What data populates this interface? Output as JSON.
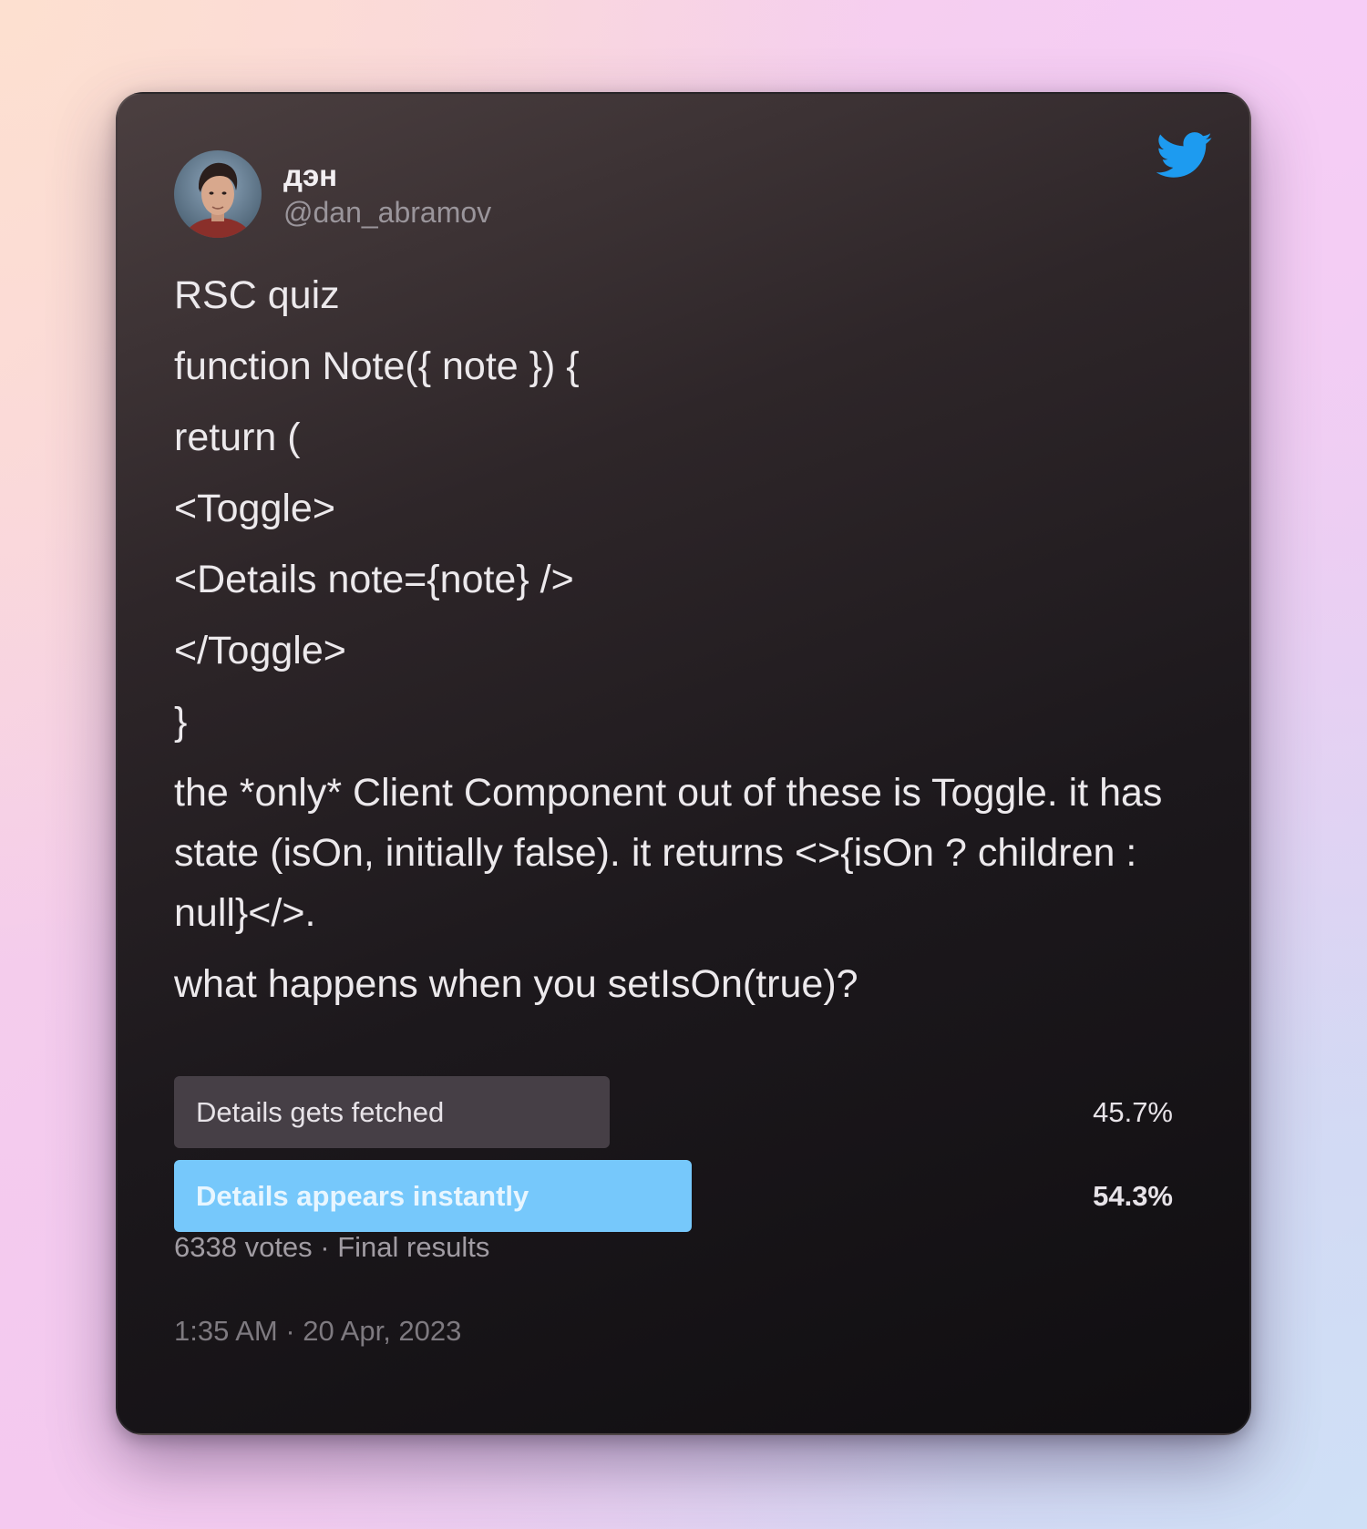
{
  "author": {
    "display_name": "дэн",
    "handle": "@dan_abramov"
  },
  "tweet": {
    "lines": [
      "RSC quiz",
      "function Note({ note }) {",
      "return (",
      "<Toggle>",
      "<Details note={note} />",
      "</Toggle>",
      "}"
    ],
    "paragraph": "the *only* Client Component out of these is Toggle. it has state (isOn, initially false). it returns <>{isOn ? children : null}</>.",
    "question": "what happens when you setIsOn(true)?"
  },
  "poll": {
    "options": [
      {
        "label": "Details gets fetched",
        "percent_text": "45.7%",
        "percent": 45.7,
        "winner": false
      },
      {
        "label": "Details appears instantly",
        "percent_text": "54.3%",
        "percent": 54.3,
        "winner": true
      }
    ],
    "votes_text": "6338 votes · Final results"
  },
  "timestamp": "1:35 AM · 20 Apr, 2023",
  "icons": {
    "brand": "twitter-bird-icon",
    "avatar": "profile-photo"
  },
  "colors": {
    "twitter_blue": "#1d9bf0",
    "winner_bar": "#76c8fb",
    "loser_bar": "#463f46",
    "winner_text": "#e8f6ff"
  }
}
